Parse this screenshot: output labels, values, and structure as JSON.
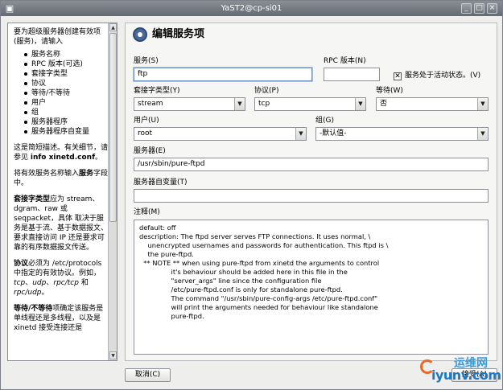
{
  "window": {
    "title": "YaST2@cp-si01",
    "menu_icon": "window-menu-icon",
    "minimize": "_",
    "maximize": "□",
    "close": "×"
  },
  "help": {
    "intro": "要为超级服务器创建有效项(服务)，请输入",
    "bullets": [
      "服务名称",
      "RPC 版本(可选)",
      "套接字类型",
      "协议",
      "等待/不等待",
      "用户",
      "组",
      "服务器程序",
      "服务器程序自变量"
    ],
    "p_short_pre": "这是简短描述。有关细节，请参见 ",
    "p_short_bold": "info xinetd.conf",
    "p_short_post": "。",
    "p_service_pre": "将有效服务名称输入",
    "p_service_bold": "服务",
    "p_service_post": "字段中。",
    "p_socket_bold": "套接字类型",
    "p_socket_a": "应为 stream、dgram、raw 或 seqpacket，具体 取决于服务是基于流、基于数据报文、要求直接访问 IP 还是要求可靠的有序数据报文传送。",
    "p_proto_bold": "协议",
    "p_proto_a": "必须为 /etc/protocols 中指定的有效协议。例如，",
    "p_proto_i1": "tcp",
    "p_proto_s1": "、",
    "p_proto_i2": "udp",
    "p_proto_s2": "、",
    "p_proto_i3": "rpc/tcp",
    "p_proto_s3": " 和 ",
    "p_proto_i4": "rpc/udp",
    "p_proto_s4": "。",
    "p_wait_bold": "等待/不等待",
    "p_wait_a": "项确定该服务是 单线程还是多线程，以及是 xinetd 接受连接还是"
  },
  "form": {
    "heading": "编辑服务项",
    "service": {
      "label": "服务(S)",
      "value": "ftp"
    },
    "rpc": {
      "label": "RPC 版本(N)",
      "value": ""
    },
    "active": {
      "label": "服务处于活动状态。(V)",
      "checked": "✕"
    },
    "socket": {
      "label": "套接字类型(Y)",
      "value": "stream"
    },
    "protocol": {
      "label": "协议(P)",
      "value": "tcp"
    },
    "wait": {
      "label": "等待(W)",
      "value": "否"
    },
    "user": {
      "label": "用户(U)",
      "value": "root"
    },
    "group": {
      "label": "组(G)",
      "value": "-默认值-"
    },
    "server": {
      "label": "服务器(E)",
      "value": "/usr/sbin/pure-ftpd"
    },
    "server_args": {
      "label": "服务器自变量(T)",
      "value": ""
    },
    "comment": {
      "label": "注释(M)",
      "value": "default: off\ndescription: The ftpd server serves FTP connections. It uses normal, \\\n    unencrypted usernames and passwords for authentication. This ftpd is \\\n    the pure-ftpd.\n  ** NOTE ** when using pure-ftpd from xinetd the arguments to control\n               it's behaviour should be added here in this file in the\n               \"server_args\" line since the configuration file\n               /etc/pure-ftpd.conf is only for standalone pure-ftpd.\n               The command \"/usr/sbin/pure-config-args /etc/pure-ftpd.conf\"\n               will print the arguments needed for behaviour like standalone\n               pure-ftpd."
    }
  },
  "buttons": {
    "cancel": "取消(C)",
    "accept": "接受(A)"
  },
  "watermark": {
    "cn": "运维网",
    "en": "iyunv.com"
  }
}
